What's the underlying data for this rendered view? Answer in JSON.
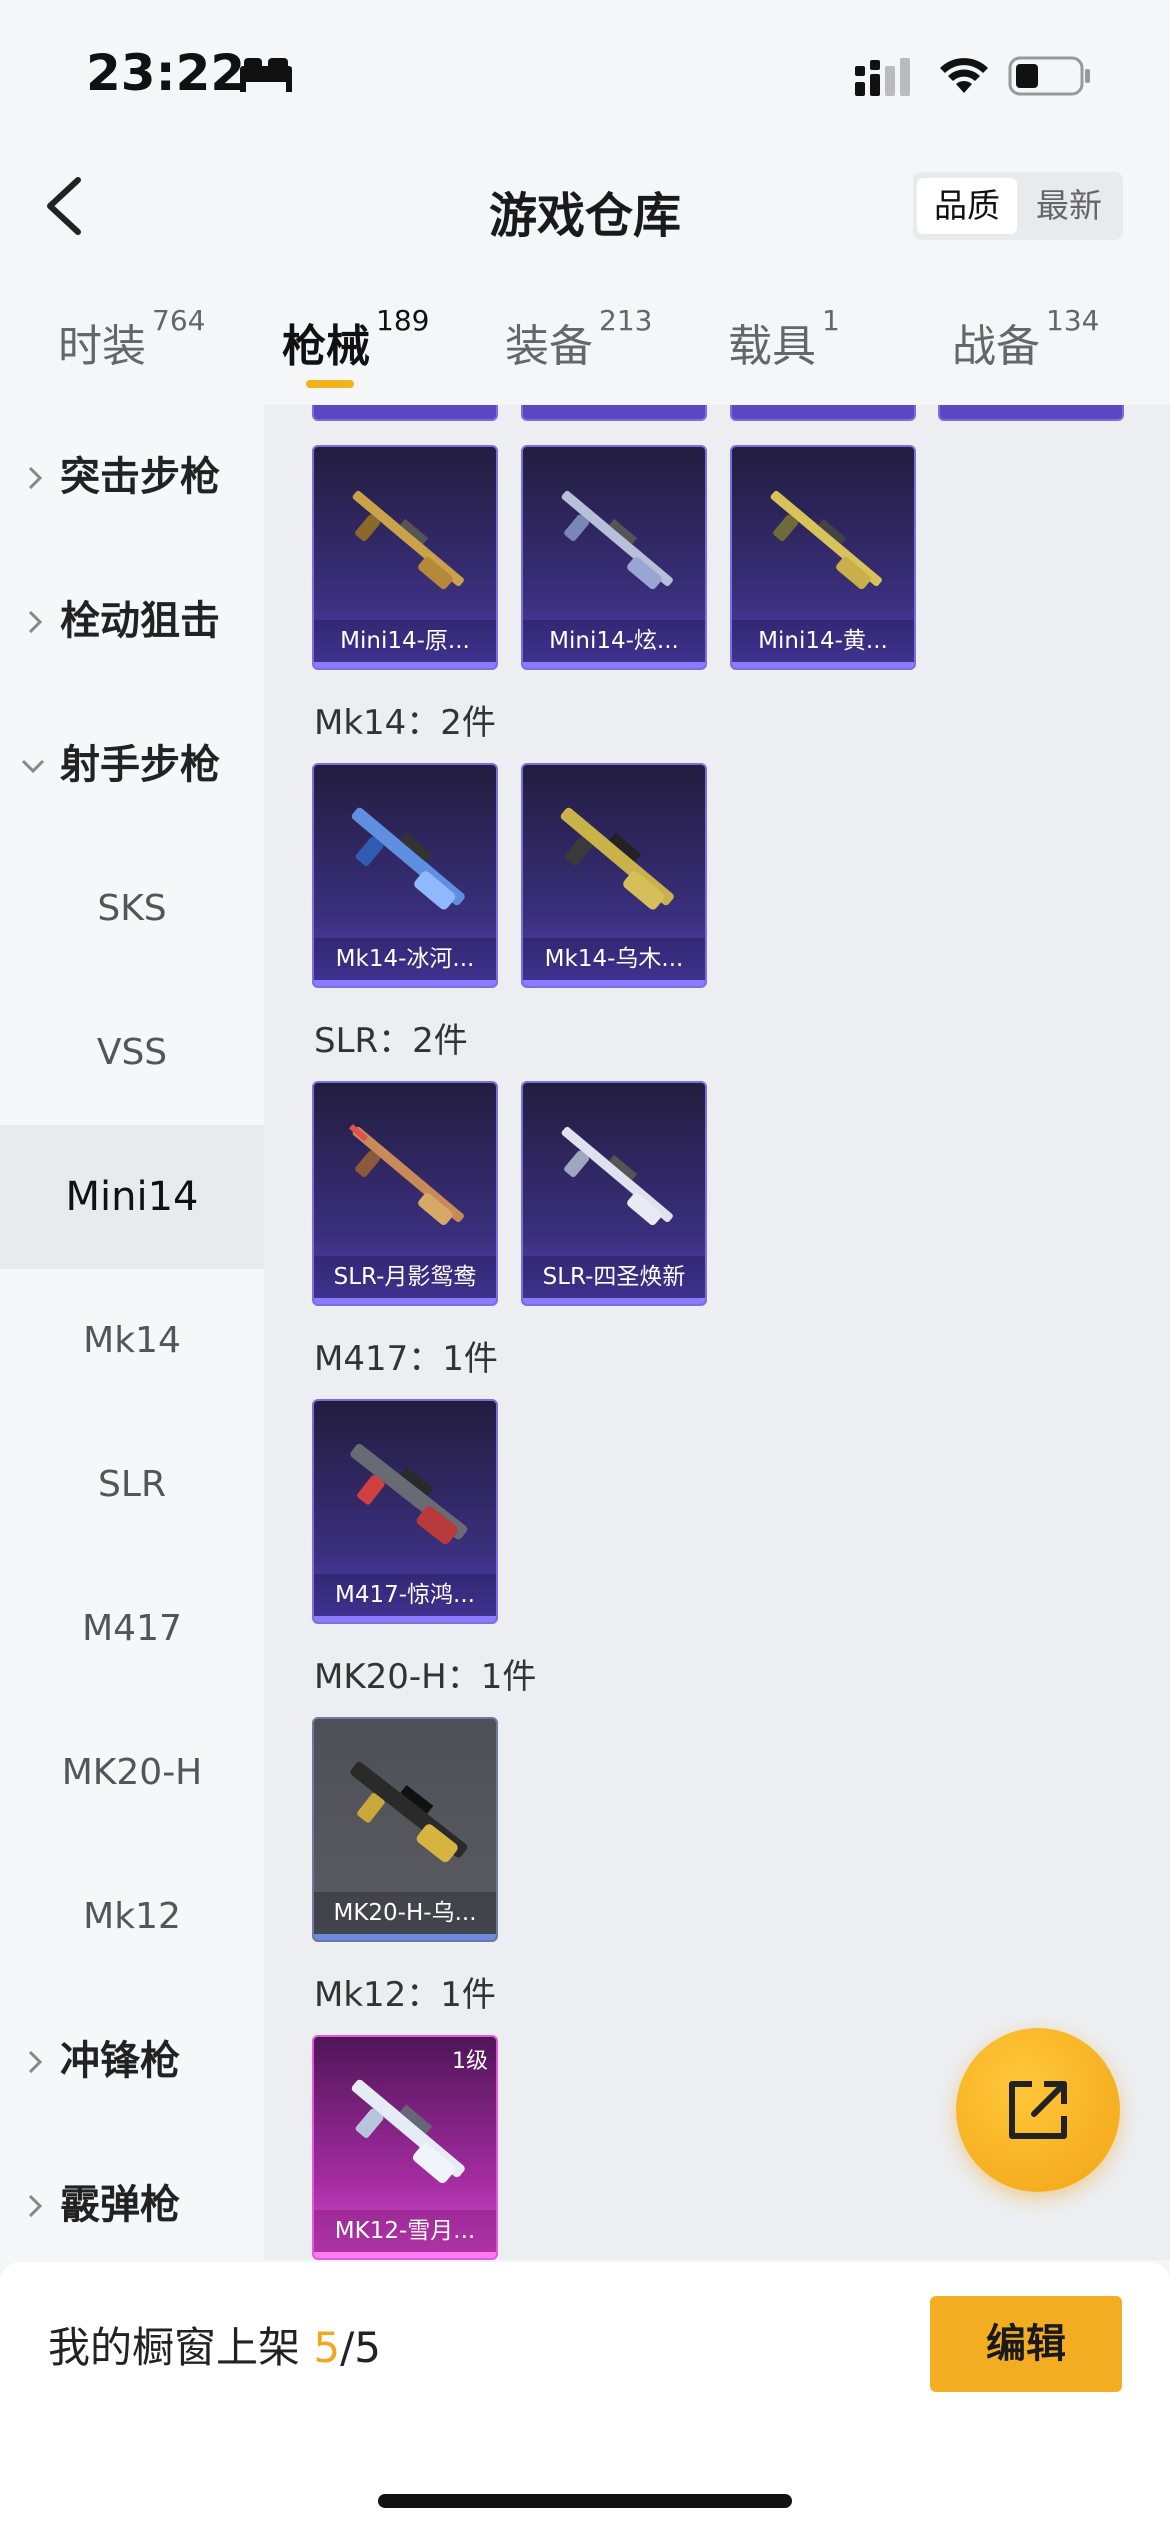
{
  "status_bar": {
    "time": "23:22"
  },
  "nav": {
    "title": "游戏仓库",
    "sort_quality": "品质",
    "sort_latest": "最新"
  },
  "tabs": [
    {
      "label": "时装",
      "count": "764"
    },
    {
      "label": "枪械",
      "count": "189"
    },
    {
      "label": "装备",
      "count": "213"
    },
    {
      "label": "载具",
      "count": "1"
    },
    {
      "label": "战备",
      "count": "134"
    }
  ],
  "sidebar": {
    "cat_assault": "突击步枪",
    "cat_bolt": "栓动狙击",
    "cat_marksman": "射手步枪",
    "sks": "SKS",
    "vss": "VSS",
    "mini14": "Mini14",
    "mk14": "Mk14",
    "slr": "SLR",
    "m417": "M417",
    "mk20h": "MK20-H",
    "mk12": "Mk12",
    "cat_smg": "冲锋枪",
    "cat_shotgun": "霰弹枪"
  },
  "groups": {
    "mk14": "Mk14：2件",
    "slr": "SLR：2件",
    "m417": "M417：1件",
    "mk20h": "MK20-H：1件",
    "mk12": "Mk12：1件"
  },
  "cards": {
    "mini14_1": "Mini14-原...",
    "mini14_2": "Mini14-炫...",
    "mini14_3": "Mini14-黄...",
    "mk14_1": "Mk14-冰河...",
    "mk14_2": "Mk14-乌木...",
    "slr_1": "SLR-月影鸳鸯",
    "slr_2": "SLR-四圣焕新",
    "m417_1": "M417-惊鸿...",
    "mk20h_1": "MK20-H-乌...",
    "mk12_1": "MK12-雪月...",
    "mk12_1_level": "1级"
  },
  "bottom": {
    "showcase_label": "我的橱窗上架",
    "used": "5",
    "total": "/5",
    "edit": "编辑"
  },
  "colors": {
    "accent": "#f3ad22",
    "purple_rarity": "#5a47c2",
    "pink_rarity": "#d64ccf",
    "gray_rarity": "#5b5c63"
  },
  "icons": [
    "bed-icon",
    "signal-icon",
    "wifi-icon",
    "battery-icon",
    "back-chevron-icon",
    "chevron-right-icon",
    "chevron-down-icon",
    "share-external-icon"
  ]
}
